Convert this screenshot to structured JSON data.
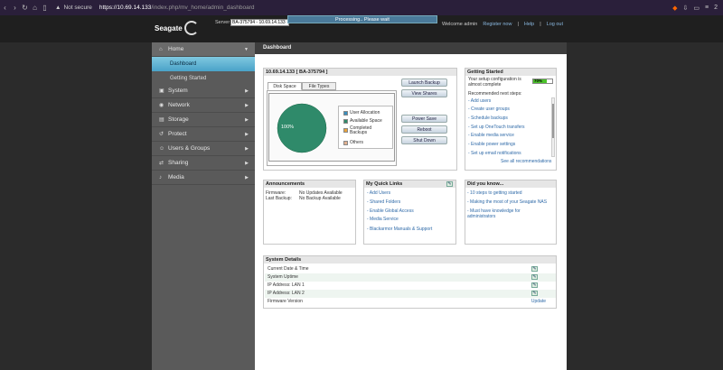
{
  "browser": {
    "security": "Not secure",
    "url_host": "https://10.69.14.133",
    "url_path": "/index.php/mv_home/admin_dashboard",
    "right_label": "2"
  },
  "header": {
    "logo_text": "Seagate",
    "server_label": "Server",
    "server_value": "BA-375794 - 10.69.14.133",
    "processing": "Processing.. Please wait",
    "welcome": "Welcome admin",
    "register": "Register now",
    "help": "Help",
    "logout": "Log out"
  },
  "sidebar": {
    "items": [
      {
        "label": "Home",
        "icon": "home-icon"
      },
      {
        "label": "System",
        "icon": "system-icon"
      },
      {
        "label": "Network",
        "icon": "network-icon"
      },
      {
        "label": "Storage",
        "icon": "storage-icon"
      },
      {
        "label": "Protect",
        "icon": "protect-icon"
      },
      {
        "label": "Users & Groups",
        "icon": "users-icon"
      },
      {
        "label": "Sharing",
        "icon": "sharing-icon"
      },
      {
        "label": "Media",
        "icon": "media-icon"
      }
    ],
    "sub": [
      {
        "label": "Dashboard"
      },
      {
        "label": "Getting Started"
      }
    ]
  },
  "main": {
    "title": "Dashboard"
  },
  "device": {
    "title": "10.69.14.133 [ BA-375794 ]",
    "tabs": [
      "Disk Space",
      "File Types"
    ],
    "pie_label": "100%",
    "legend": [
      {
        "label": "User Allocation",
        "color": "#3a8fbf"
      },
      {
        "label": "Available Space",
        "color": "#2f8a6a"
      },
      {
        "label": "Completed Backups",
        "color": "#e8a23a"
      },
      {
        "label": "Others",
        "color": "#e0b090"
      }
    ],
    "buttons": [
      "Launch Backup",
      "View Shares",
      "Power Save",
      "Reboot",
      "Shut Down"
    ]
  },
  "getting_started": {
    "title": "Getting Started",
    "status": "Your setup configuration is almost complete",
    "progress_label": "70%",
    "progress": 0.7,
    "next_label": "Recommended next steps:",
    "links": [
      "- Add users",
      "- Create user groups",
      "- Schedule backups",
      "- Set up OneTouch transfers",
      "- Enable media service",
      "- Enable power settings",
      "- Set up email notifications"
    ],
    "see_all": "See all recommendations"
  },
  "announcements": {
    "title": "Announcements",
    "firmware_label": "Firmware:",
    "firmware_value": "No Updates Available",
    "backup_label": "Last Backup:",
    "backup_value": "No Backup Available"
  },
  "quick_links": {
    "title": "My Quick Links",
    "links": [
      "- Add Users",
      "- Shared Folders",
      "- Enable Global Access",
      "- Media Service",
      "- Blackarmor Manuals & Support"
    ]
  },
  "did_you_know": {
    "title": "Did you know...",
    "links": [
      "- 10 steps to getting started",
      "- Making the most of your Seagate NAS",
      "- Must have knowledge for administrators"
    ]
  },
  "system_details": {
    "title": "System Details",
    "rows": [
      "Current Date & Time",
      "System Uptime",
      "IP Address: LAN 1",
      "IP Address: LAN 2",
      "Firmware Version"
    ],
    "update": "Update"
  }
}
